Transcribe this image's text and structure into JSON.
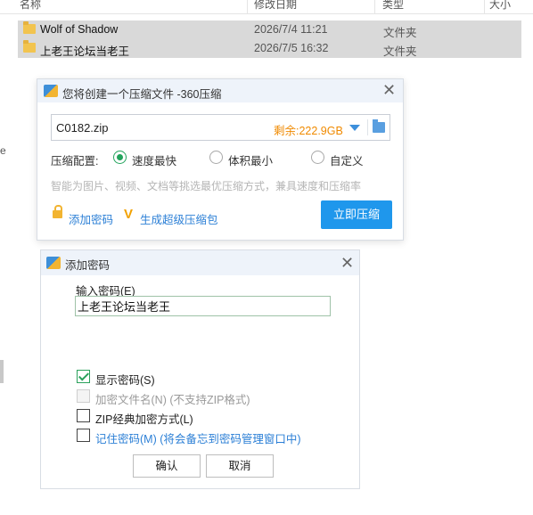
{
  "explorer": {
    "columns": {
      "name": "名称",
      "date": "修改日期",
      "type": "类型",
      "size": "大小"
    },
    "rows": [
      {
        "name": "Wolf of Shadow",
        "date": "2026/7/4 11:21",
        "type": "文件夹"
      },
      {
        "name": "上老王论坛当老王",
        "date": "2026/7/5 16:32",
        "type": "文件夹"
      }
    ],
    "left_cut_glyph": "e"
  },
  "compress_dialog": {
    "title": "您将创建一个压缩文件 -360压缩",
    "filename": "C0182.zip",
    "free_space": "剩余:222.9GB",
    "config_label": "压缩配置:",
    "options": [
      "速度最快",
      "体积最小",
      "自定义"
    ],
    "selected_option": "速度最快",
    "hint": "智能为图片、视频、文档等挑选最优压缩方式，兼具速度和压缩率",
    "add_password_link": "添加密码",
    "super_compress_link": "生成超级压缩包",
    "compress_button": "立即压缩",
    "colors": {
      "accent": "#1f97ec",
      "space": "#f08a00",
      "radio": "#21a35b"
    }
  },
  "password_dialog": {
    "title": "添加密码",
    "input_label": "输入密码(E)",
    "password_value": "上老王论坛当老王",
    "checkboxes": [
      {
        "label": "显示密码(S)",
        "checked": true,
        "disabled": false
      },
      {
        "label": "加密文件名(N) (不支持ZIP格式)",
        "checked": false,
        "disabled": true
      },
      {
        "label": "ZIP经典加密方式(L)",
        "checked": false,
        "disabled": false
      },
      {
        "label": "记住密码(M) (将会备忘到密码管理窗口中)",
        "checked": false,
        "disabled": false
      }
    ],
    "ok_button": "确认",
    "cancel_button": "取消"
  }
}
